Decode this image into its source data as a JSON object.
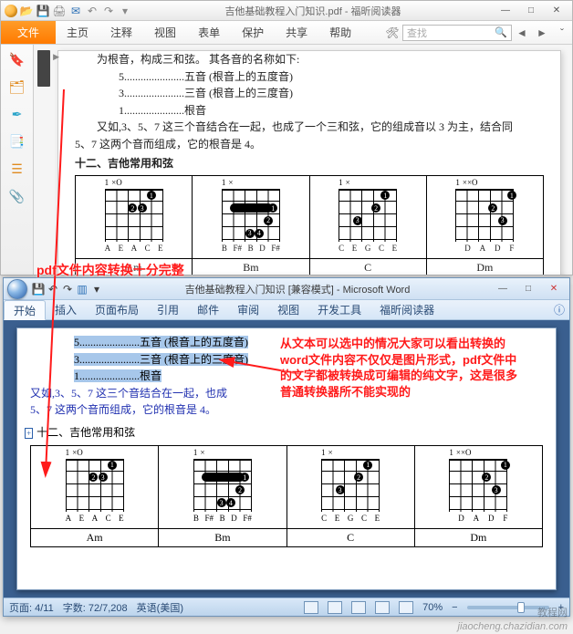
{
  "foxit": {
    "title": "吉他基础教程入门知识.pdf - 福昕阅读器",
    "ribbon": {
      "file": "文件",
      "tabs": [
        "主页",
        "注释",
        "视图",
        "表单",
        "保护",
        "共享",
        "帮助"
      ],
      "search_placeholder": "查找"
    },
    "sidebar_icons": [
      "bookmark",
      "page-thumb",
      "signature",
      "layers",
      "list",
      "attachment"
    ]
  },
  "doc": {
    "line_root": "为根音，构成三和弦。 其各音的名称如下:",
    "line5": "5......................五音 (根音上的五度音)",
    "line3": "3......................三音 (根音上的三度音)",
    "line1": "1......................根音",
    "line_ex": "又如,3、5、7 这三个音结合在一起，也成了一个三和弦，它的组成音以 3 为主，结合同",
    "line_ex2": "5、7 这两个音而组成，它的根音是 4。",
    "heading": "十二、吉他常用和弦",
    "chords": [
      {
        "name": "Am",
        "top": "×O",
        "fret": "1",
        "letters": [
          "A",
          "E",
          "A",
          "C",
          "E"
        ]
      },
      {
        "name": "Bm",
        "top": "×",
        "fret": "1",
        "letters": [
          "B",
          "F#",
          "B",
          "D",
          "F#"
        ]
      },
      {
        "name": "C",
        "top": "×",
        "fret": "1",
        "letters": [
          "C",
          "E",
          "G",
          "C",
          "E"
        ]
      },
      {
        "name": "Dm",
        "top": "××O",
        "fret": "1",
        "letters": [
          "D",
          "A",
          "D",
          "F"
        ]
      }
    ]
  },
  "annotations": {
    "top": "pdf文件内容转换十分完整",
    "right1": "从文本可以选中的情况大家可以看出转换的",
    "right2": "word文件内容不仅仅是图片形式，pdf文件中",
    "right3": "的文字都被转换成可编辑的纯文字，这是很多",
    "right4": "普通转换器所不能实现的"
  },
  "word": {
    "title": "吉他基础教程入门知识 [兼容模式] - Microsoft Word",
    "tabs": [
      "开始",
      "插入",
      "页面布局",
      "引用",
      "邮件",
      "审阅",
      "视图",
      "开发工具",
      "福昕阅读器"
    ],
    "doc": {
      "line5": "5......................五音 (根音上的五度音)",
      "line3": "3......................三音 (根音上的三度音)",
      "line1": "1......................根音",
      "line_ex": "又如,3、5、7 这三个音结合在一起，也成",
      "line_ex2": "5、7 这两个音而组成，它的根音是 4。",
      "heading": "十二、吉他常用和弦"
    },
    "status": {
      "page": "页面: 4/11",
      "words": "字数: 72/7,208",
      "lang": "英语(美国)",
      "zoom": "70%"
    }
  },
  "watermark1": "教程网",
  "watermark2": "jiaocheng.chazidian.com"
}
